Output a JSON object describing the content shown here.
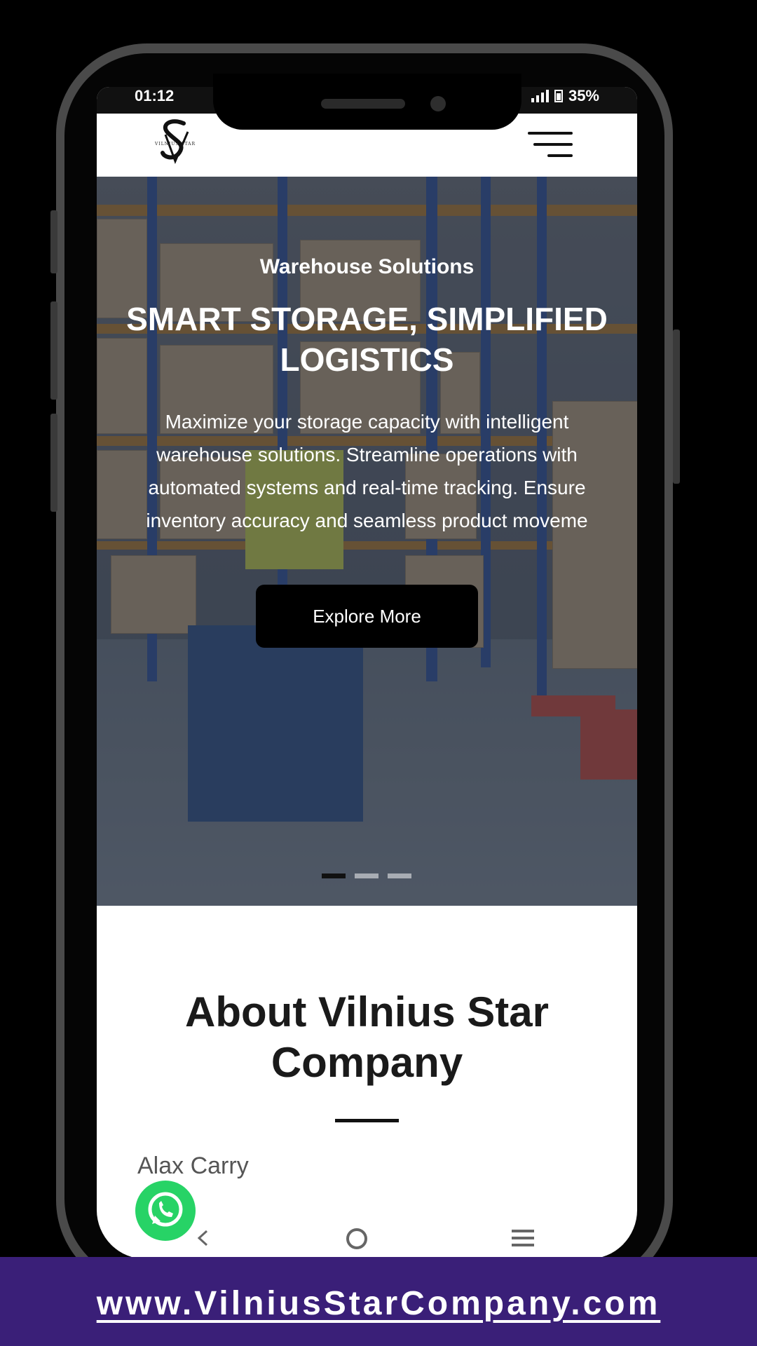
{
  "status_bar": {
    "time": "01:12",
    "battery": "35%"
  },
  "brand": {
    "logo_letters": "SV",
    "logo_subtext": "VILNIUS STAR"
  },
  "hero": {
    "subtitle": "Warehouse Solutions",
    "title": "SMART STORAGE, SIMPLIFIED LOGISTICS",
    "description": "Maximize your storage capacity with intelligent warehouse solutions. Streamline operations with automated systems and real-time tracking. Ensure inventory accuracy and seamless product moveme",
    "cta_label": "Explore More",
    "slides_total": 3,
    "active_slide": 1
  },
  "about": {
    "title": "About Vilnius Star Company",
    "author_name": "Alax Carry"
  },
  "footer_banner": {
    "url": "www.VilniusStarCompany.com"
  },
  "icons": {
    "menu": "hamburger-menu-icon",
    "whatsapp": "whatsapp-icon",
    "nav_back": "chevron-left-icon",
    "nav_home": "circle-home-icon",
    "nav_recents": "recents-lines-icon"
  },
  "colors": {
    "banner_background": "#3a1f78",
    "cta_background": "#000000",
    "whatsapp_green": "#27d366",
    "phone_frame": "#4a4a4a"
  }
}
